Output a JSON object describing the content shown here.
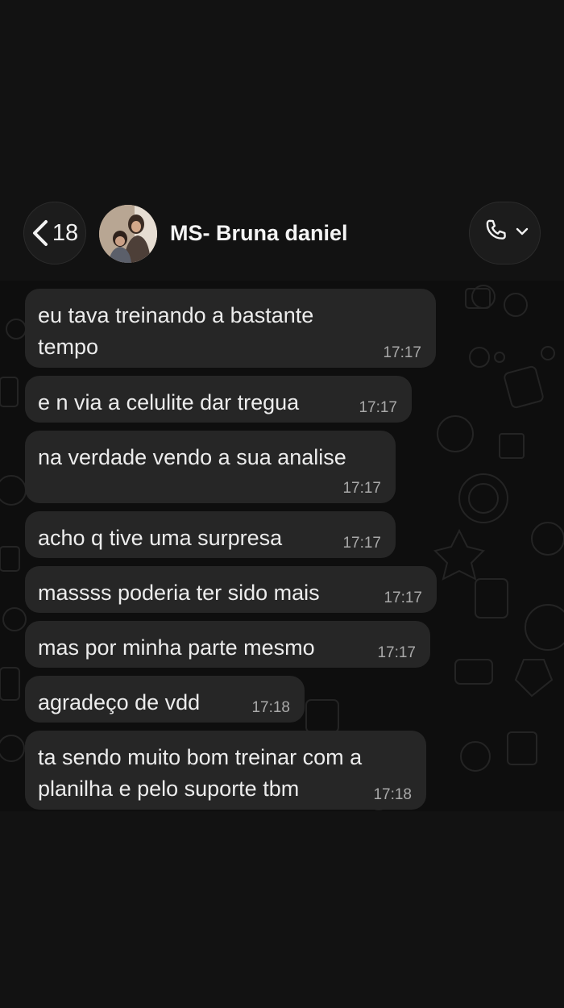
{
  "header": {
    "back_count": "18",
    "contact_name": "MS- Bruna daniel"
  },
  "messages": [
    {
      "text": "eu tava treinando a bastante\ntempo",
      "time": "17:17"
    },
    {
      "text": "e n via a celulite dar tregua",
      "time": "17:17"
    },
    {
      "text": "na verdade vendo a sua analise",
      "time": "17:17"
    },
    {
      "text": "acho q tive uma surpresa",
      "time": "17:17"
    },
    {
      "text": "massss poderia ter sido mais",
      "time": "17:17"
    },
    {
      "text": "mas por minha parte mesmo",
      "time": "17:17"
    },
    {
      "text": "agradeço de vdd",
      "time": "17:18"
    },
    {
      "text": "ta sendo muito bom treinar com a\nplanilha e pelo suporte tbm",
      "time": "17:18"
    }
  ],
  "colors": {
    "background": "#121212",
    "bubble": "#262626",
    "timestamp": "#a9a9a9"
  }
}
